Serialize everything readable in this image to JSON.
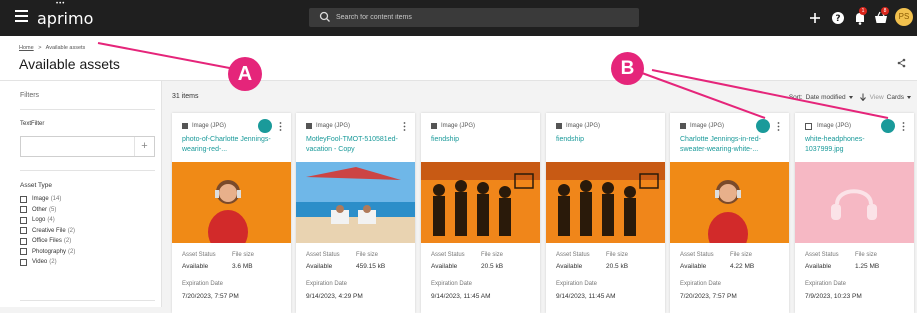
{
  "app": {
    "logo": "aprimo"
  },
  "search": {
    "placeholder": "Search for content items"
  },
  "topbar": {
    "notifications_badge": "1",
    "cart_badge": "8",
    "avatar_initials": "PS"
  },
  "breadcrumb": {
    "home": "Home",
    "separator": ">",
    "current": "Available assets"
  },
  "page": {
    "title": "Available assets"
  },
  "sidebar": {
    "filters_label": "Filters",
    "textfilter_label": "TextFilter",
    "textfilter_value": "",
    "textfilter_add": "+",
    "asset_type_label": "Asset Type",
    "asset_types": [
      {
        "label": "Image",
        "count": "(14)"
      },
      {
        "label": "Other",
        "count": "(5)"
      },
      {
        "label": "Logo",
        "count": "(4)"
      },
      {
        "label": "Creative File",
        "count": "(2)"
      },
      {
        "label": "Office Files",
        "count": "(2)"
      },
      {
        "label": "Photography",
        "count": "(2)"
      },
      {
        "label": "Video",
        "count": "(2)"
      }
    ]
  },
  "results": {
    "count_label": "31 items",
    "sort_prefix": "Sort:",
    "sort_value": "Date modified",
    "view_prefix": "View",
    "view_value": "Cards"
  },
  "field_labels": {
    "asset_status": "Asset Status",
    "file_size": "File size",
    "expiration_date": "Expiration Date"
  },
  "cards": [
    {
      "type": "Image (JPG)",
      "title": "photo-of-Charlotte Jennings-wearing-red-...",
      "status": "Available",
      "size": "3.6 MB",
      "expiration": "7/20/2023, 7:57 PM",
      "in_workspace": true
    },
    {
      "type": "Image (JPG)",
      "title": "MotleyFool-TMOT-510581ed-vacation - Copy",
      "status": "Available",
      "size": "459.15 kB",
      "expiration": "9/14/2023, 4:29 PM",
      "in_workspace": false
    },
    {
      "type": "Image (JPG)",
      "title": "fiendship",
      "status": "Available",
      "size": "20.5 kB",
      "expiration": "9/14/2023, 11:45 AM",
      "in_workspace": false
    },
    {
      "type": "Image (JPG)",
      "title": "fiendship",
      "status": "Available",
      "size": "20.5 kB",
      "expiration": "9/14/2023, 11:45 AM",
      "in_workspace": false
    },
    {
      "type": "Image (JPG)",
      "title": "Charlotte Jennings-in-red-sweater-wearing-white-...",
      "status": "Available",
      "size": "4.22 MB",
      "expiration": "7/20/2023, 7:57 PM",
      "in_workspace": true
    },
    {
      "type": "Image (JPG)",
      "title": "white-headphones-1037999.jpg",
      "status": "Available",
      "size": "1.25 MB",
      "expiration": "7/9/2023, 10:23 PM",
      "in_workspace": true
    }
  ],
  "callouts": {
    "a": "A",
    "b": "B"
  },
  "colors": {
    "accent": "#1a9a9a",
    "callout": "#e5257a",
    "topbar": "#1f1f1f"
  }
}
